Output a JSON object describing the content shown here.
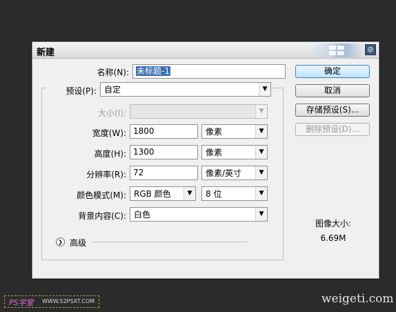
{
  "dialog": {
    "title": "新建",
    "close_icon": "close-icon"
  },
  "fields": {
    "name": {
      "label": "名称(N):",
      "value": "未标题-1"
    },
    "preset": {
      "label": "预设(P):",
      "value": "自定"
    },
    "size": {
      "label": "大小(I):",
      "value": ""
    },
    "width": {
      "label": "宽度(W):",
      "value": "1800",
      "unit": "像素"
    },
    "height": {
      "label": "高度(H):",
      "value": "1300",
      "unit": "像素"
    },
    "resolution": {
      "label": "分辨率(R):",
      "value": "72",
      "unit": "像素/英寸"
    },
    "color_mode": {
      "label": "颜色模式(M):",
      "value": "RGB 颜色",
      "depth": "8 位"
    },
    "background": {
      "label": "背景内容(C):",
      "value": "白色"
    },
    "advanced": {
      "label": "高级"
    }
  },
  "buttons": {
    "ok": "确定",
    "cancel": "取消",
    "save_preset": "存储预设(S)...",
    "delete_preset": "删除预设(D)..."
  },
  "image_size": {
    "label": "图像大小:",
    "value": "6.69M"
  },
  "footer": {
    "logo_text": "PS学堂",
    "logo_url_text": "WWW.52PSXT.COM",
    "watermark": "weigeti.com"
  },
  "colors": {
    "background": "#2b2b2b",
    "dialog": "#f0f0f0",
    "selection": "#3a6fb0",
    "primary_button": "#bee6fd"
  }
}
